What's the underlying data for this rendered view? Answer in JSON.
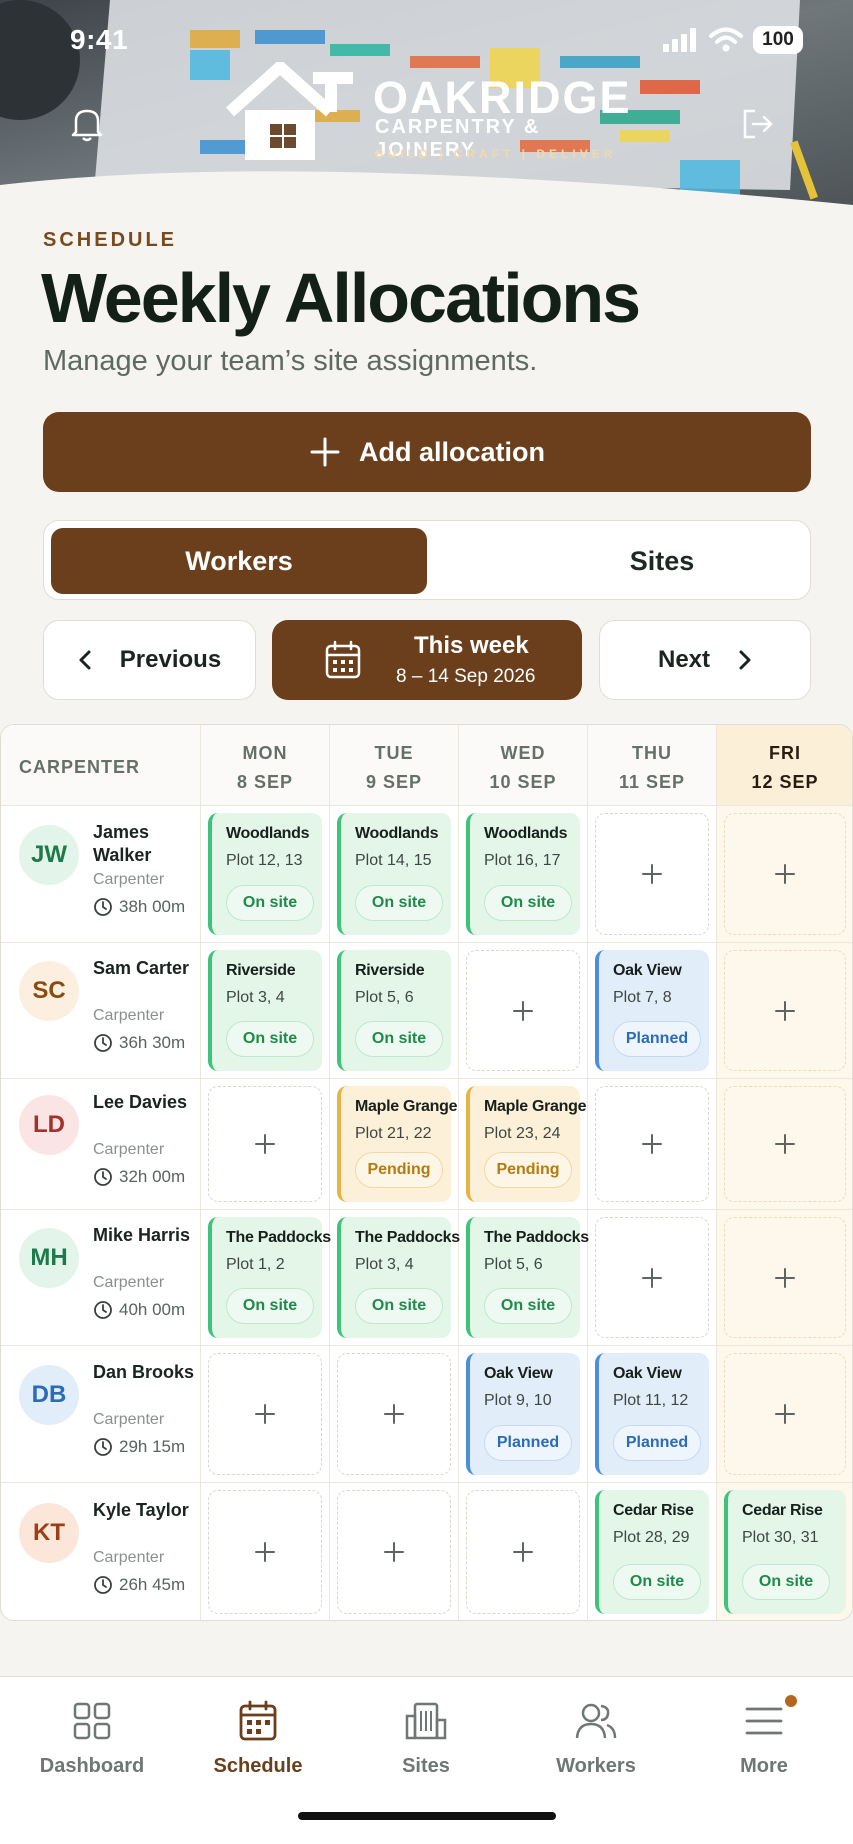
{
  "status_bar": {
    "time": "9:41",
    "battery": "100"
  },
  "brand": {
    "name": "OAKRIDGE",
    "sub": "CARPENTRY & JOINERY",
    "tagline": "BUILD  |  CRAFT  |  DELIVER"
  },
  "header": {
    "eyebrow": "SCHEDULE",
    "title": "Weekly Allocations",
    "subtitle": "Manage your team’s site assignments."
  },
  "add_button": {
    "label": "Add allocation"
  },
  "toggle": {
    "workers": "Workers",
    "sites": "Sites",
    "active": "Workers"
  },
  "week_nav": {
    "previous": "Previous",
    "next": "Next",
    "current_label": "This week",
    "current_range": "8 – 14 Sep 2026"
  },
  "table": {
    "first_header": "CARPENTER",
    "days": [
      {
        "day": "MON",
        "date": "8 SEP",
        "today": false
      },
      {
        "day": "TUE",
        "date": "9 SEP",
        "today": false
      },
      {
        "day": "WED",
        "date": "10 SEP",
        "today": false
      },
      {
        "day": "THU",
        "date": "11 SEP",
        "today": false
      },
      {
        "day": "FRI",
        "date": "12 SEP",
        "today": true
      }
    ],
    "rows": [
      {
        "initials": "JW",
        "name": "James Walker",
        "role": "Carpenter",
        "hours": "38h 00m",
        "avatar_bg": "#e3f5ea",
        "avatar_fg": "#1e7a4a",
        "cells": [
          {
            "site": "Woodlands",
            "plot": "Plot 12, 13",
            "status": "On site",
            "kind": "onsite"
          },
          {
            "site": "Woodlands",
            "plot": "Plot 14, 15",
            "status": "On site",
            "kind": "onsite"
          },
          {
            "site": "Woodlands",
            "plot": "Plot 16, 17",
            "status": "On site",
            "kind": "onsite"
          },
          null,
          null
        ]
      },
      {
        "initials": "SC",
        "name": "Sam Carter",
        "role": "Carpenter",
        "hours": "36h 30m",
        "avatar_bg": "#fcefdf",
        "avatar_fg": "#8a4a12",
        "cells": [
          {
            "site": "Riverside",
            "plot": "Plot 3, 4",
            "status": "On site",
            "kind": "onsite"
          },
          {
            "site": "Riverside",
            "plot": "Plot 5, 6",
            "status": "On site",
            "kind": "onsite"
          },
          null,
          {
            "site": "Oak View",
            "plot": "Plot 7, 8",
            "status": "Planned",
            "kind": "planned"
          },
          null
        ]
      },
      {
        "initials": "LD",
        "name": "Lee Davies",
        "role": "Carpenter",
        "hours": "32h 00m",
        "avatar_bg": "#fbe4e4",
        "avatar_fg": "#a3302c",
        "cells": [
          null,
          {
            "site": "Maple Grange",
            "plot": "Plot 21, 22",
            "status": "Pending",
            "kind": "pending"
          },
          {
            "site": "Maple Grange",
            "plot": "Plot 23, 24",
            "status": "Pending",
            "kind": "pending"
          },
          null,
          null
        ]
      },
      {
        "initials": "MH",
        "name": "Mike Harris",
        "role": "Carpenter",
        "hours": "40h 00m",
        "avatar_bg": "#e3f5ea",
        "avatar_fg": "#1e7a4a",
        "cells": [
          {
            "site": "The Paddocks",
            "plot": "Plot 1, 2",
            "status": "On site",
            "kind": "onsite"
          },
          {
            "site": "The Paddocks",
            "plot": "Plot 3, 4",
            "status": "On site",
            "kind": "onsite"
          },
          {
            "site": "The Paddocks",
            "plot": "Plot 5, 6",
            "status": "On site",
            "kind": "onsite"
          },
          null,
          null
        ]
      },
      {
        "initials": "DB",
        "name": "Dan Brooks",
        "role": "Carpenter",
        "hours": "29h 15m",
        "avatar_bg": "#e2edfa",
        "avatar_fg": "#2a6cb5",
        "cells": [
          null,
          null,
          {
            "site": "Oak View",
            "plot": "Plot 9, 10",
            "status": "Planned",
            "kind": "planned"
          },
          {
            "site": "Oak View",
            "plot": "Plot 11, 12",
            "status": "Planned",
            "kind": "planned"
          },
          null
        ]
      },
      {
        "initials": "KT",
        "name": "Kyle Taylor",
        "role": "Carpenter",
        "hours": "26h 45m",
        "avatar_bg": "#fce6da",
        "avatar_fg": "#9a3e16",
        "cells": [
          null,
          null,
          null,
          {
            "site": "Cedar Rise",
            "plot": "Plot 28, 29",
            "status": "On site",
            "kind": "onsite"
          },
          {
            "site": "Cedar Rise",
            "plot": "Plot 30, 31",
            "status": "On site",
            "kind": "onsite"
          }
        ]
      }
    ]
  },
  "tabbar": {
    "items": [
      {
        "label": "Dashboard",
        "icon": "dashboard-icon",
        "active": false
      },
      {
        "label": "Schedule",
        "icon": "calendar-icon",
        "active": true
      },
      {
        "label": "Sites",
        "icon": "building-icon",
        "active": false
      },
      {
        "label": "Workers",
        "icon": "users-icon",
        "active": false
      },
      {
        "label": "More",
        "icon": "menu-icon",
        "active": false
      }
    ]
  },
  "colors": {
    "brand": "#6b3f1b",
    "onsite": "#3fc27a",
    "planned": "#4a8fd8",
    "pending": "#e5b445"
  }
}
